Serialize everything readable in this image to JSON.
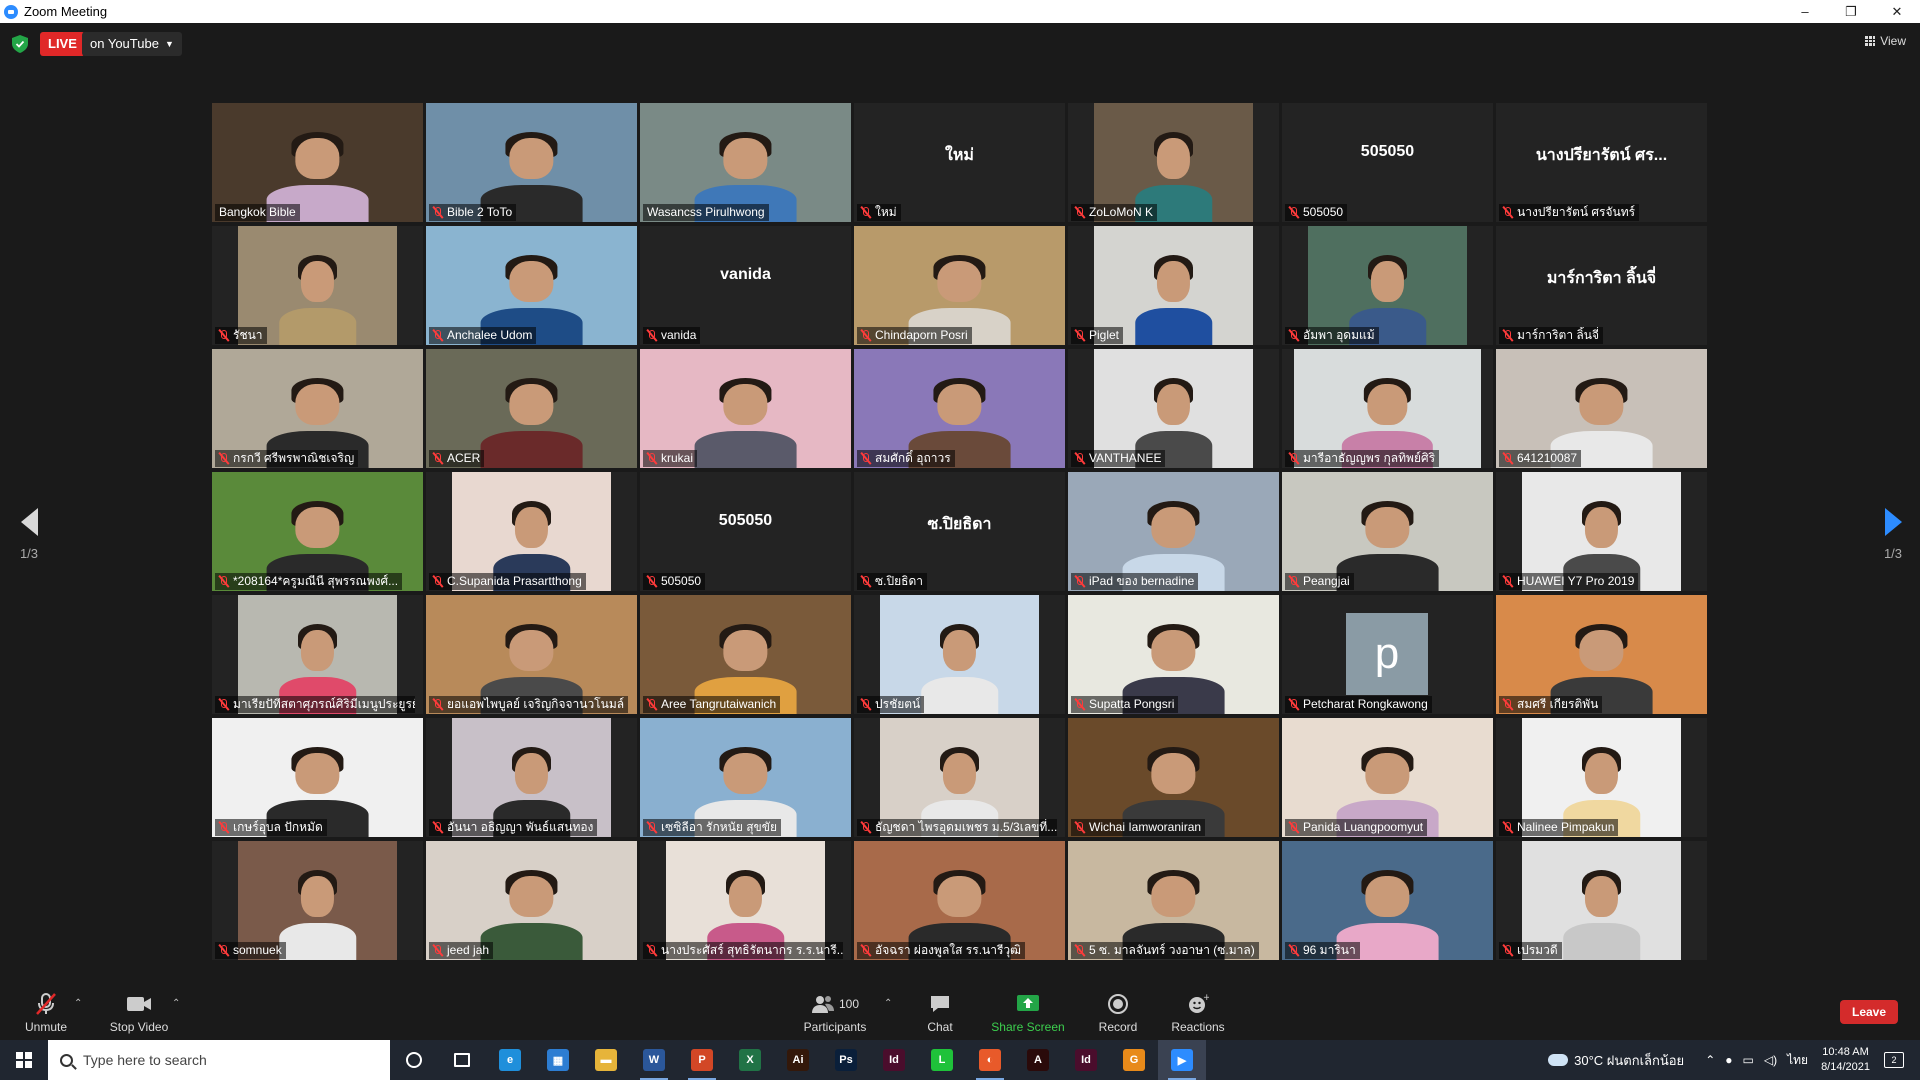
{
  "window": {
    "title": "Zoom Meeting",
    "minimize": "–",
    "restore": "❐",
    "close": "✕"
  },
  "header": {
    "live_label": "LIVE",
    "stream_target": "on YouTube",
    "view_label": "View"
  },
  "pagination": {
    "left": "1/3",
    "right": "1/3"
  },
  "participants": [
    {
      "name": "Bangkok Bible",
      "muted": false,
      "video": true,
      "active": true,
      "bg": "#4a3a2c",
      "shirt": "#c7a9c9",
      "frame": "full"
    },
    {
      "name": "Bible 2 ToTo",
      "muted": true,
      "video": true,
      "bg": "#6f8fa8",
      "shirt": "#2a2a2a",
      "frame": "full"
    },
    {
      "name": "Wasancss Pirulhwong",
      "muted": false,
      "video": true,
      "bg": "#7a8a86",
      "shirt": "#3f78b8",
      "frame": "full"
    },
    {
      "name": "ใหม่",
      "muted": true,
      "video": false,
      "display": "ใหม่"
    },
    {
      "name": "ZoLoMoN K",
      "muted": true,
      "video": true,
      "bg": "#6a5a48",
      "shirt": "#2d7a7a",
      "frame": "narrow"
    },
    {
      "name": "505050",
      "muted": true,
      "video": false,
      "display": "505050"
    },
    {
      "name": "นางปรียารัตน์ ศรจันทร์",
      "muted": true,
      "video": false,
      "display": "นางปรียารัตน์ ศร..."
    },
    {
      "name": "รัชนา",
      "muted": true,
      "video": true,
      "bg": "#9a8a70",
      "shirt": "#b39a6a",
      "frame": "narrow"
    },
    {
      "name": "Anchalee Udom",
      "muted": true,
      "video": true,
      "bg": "#8ab4d0",
      "shirt": "#1e4c86",
      "frame": "full"
    },
    {
      "name": "vanida",
      "muted": true,
      "video": false,
      "display": "vanida"
    },
    {
      "name": "Chindaporn Posri",
      "muted": true,
      "video": true,
      "bg": "#b89a6a",
      "shirt": "#d8d2c8",
      "frame": "full"
    },
    {
      "name": "Piglet",
      "muted": true,
      "video": true,
      "bg": "#d4d4d0",
      "shirt": "#1f4fa0",
      "frame": "narrow"
    },
    {
      "name": "อัมพา อุดมแม้",
      "muted": true,
      "video": true,
      "bg": "#4f6f5f",
      "shirt": "#3a5a8a",
      "frame": "narrow"
    },
    {
      "name": "มาร์การิตา ลิ้นจี่",
      "muted": true,
      "video": false,
      "display": "มาร์การิตา ลิ้นจี่"
    },
    {
      "name": "กรกวี ศรีพรพาณิชเจริญ",
      "muted": true,
      "video": true,
      "bg": "#b0a898",
      "shirt": "#2a2a2a",
      "frame": "full"
    },
    {
      "name": "ACER",
      "muted": true,
      "video": true,
      "bg": "#6a6a58",
      "shirt": "#6a2a2a",
      "frame": "full"
    },
    {
      "name": "krukai",
      "muted": true,
      "video": true,
      "bg": "#e6b8c4",
      "shirt": "#5a5a6a",
      "frame": "full"
    },
    {
      "name": "สมศักดิ์ อุถาวร",
      "muted": true,
      "video": true,
      "bg": "#8a78b8",
      "shirt": "#6a4a3a",
      "frame": "full"
    },
    {
      "name": "VANTHANEE",
      "muted": true,
      "video": true,
      "bg": "#e0e0e0",
      "shirt": "#4a4a4a",
      "frame": "narrow"
    },
    {
      "name": "มารีอาธัญญพร กุลทิพย์ศิริ",
      "muted": true,
      "video": true,
      "bg": "#d8dcdc",
      "shirt": "#c880a8",
      "frame": "mid"
    },
    {
      "name": "641210087",
      "muted": true,
      "video": true,
      "bg": "#c8c0b8",
      "shirt": "#e8e8e8",
      "frame": "full"
    },
    {
      "name": "*208164*ครูมณีนี สุพรรณพงศ์...",
      "muted": true,
      "video": true,
      "bg": "#5a8a3a",
      "shirt": "#2a2a2a",
      "frame": "full"
    },
    {
      "name": "C.Supanida Prasartthong",
      "muted": true,
      "video": true,
      "bg": "#e8d8d0",
      "shirt": "#2a3a5a",
      "frame": "narrow"
    },
    {
      "name": "505050",
      "muted": true,
      "video": false,
      "display": "505050"
    },
    {
      "name": "ซ.ปิยธิดา",
      "muted": true,
      "video": false,
      "display": "ซ.ปิยธิดา"
    },
    {
      "name": "iPad ของ bernadine",
      "muted": true,
      "video": true,
      "bg": "#9aa8b8",
      "shirt": "#c8d8e8",
      "frame": "full"
    },
    {
      "name": "Peangjai",
      "muted": true,
      "video": true,
      "bg": "#c8c8c0",
      "shirt": "#2a2a2a",
      "frame": "full"
    },
    {
      "name": "HUAWEI Y7 Pro 2019",
      "muted": true,
      "video": true,
      "bg": "#e8e8e8",
      "shirt": "#4a4a4a",
      "frame": "narrow"
    },
    {
      "name": "มาเรียปัทีสตาศุภรณ์ศิริมีเมนูประยูรย์",
      "muted": true,
      "video": true,
      "bg": "#b8b8b0",
      "shirt": "#e04a6a",
      "frame": "narrow"
    },
    {
      "name": "ยอแอพไพบูลย์ เจริญกิจจานวโนมล์",
      "muted": true,
      "video": true,
      "bg": "#b88a5a",
      "shirt": "#4a4a4a",
      "frame": "full"
    },
    {
      "name": "Aree Tangrutaiwanich",
      "muted": true,
      "video": true,
      "bg": "#7a5a3a",
      "shirt": "#e0a040",
      "frame": "full"
    },
    {
      "name": "ปรชัยตน์",
      "muted": true,
      "video": true,
      "bg": "#c8d8e8",
      "shirt": "#e8e8e8",
      "frame": "narrow"
    },
    {
      "name": "Supatta Pongsri",
      "muted": true,
      "video": true,
      "bg": "#e8e8e0",
      "shirt": "#3a3a4a",
      "frame": "full"
    },
    {
      "name": "Petcharat Rongkawong",
      "muted": true,
      "video": false,
      "avatar": "p"
    },
    {
      "name": "สมศรี เกียรติพัน",
      "muted": true,
      "video": true,
      "bg": "#d88a4a",
      "shirt": "#3a3a3a",
      "frame": "full"
    },
    {
      "name": "เกษร์อุบล ปักหมัด",
      "muted": true,
      "video": true,
      "bg": "#f0f0f0",
      "shirt": "#2a2a2a",
      "frame": "full"
    },
    {
      "name": "อันนา อธิญญา พันธ์แสนทอง",
      "muted": true,
      "video": true,
      "bg": "#c8c0c8",
      "shirt": "#2a2a2a",
      "frame": "narrow"
    },
    {
      "name": "เซซิลีอา รักหนัย สุขขัย",
      "muted": true,
      "video": true,
      "bg": "#8ab0d0",
      "shirt": "#e8e8e8",
      "frame": "full"
    },
    {
      "name": "ธัญชดา ไพรอุดมเพชร ม.5/3เลขที่...",
      "muted": true,
      "video": true,
      "bg": "#d8d0c8",
      "shirt": "#e8e8e8",
      "frame": "narrow"
    },
    {
      "name": "Wichai Iamworaniran",
      "muted": true,
      "video": true,
      "bg": "#6a4a2a",
      "shirt": "#3a3a3a",
      "frame": "full"
    },
    {
      "name": "Panida Luangpoomyut",
      "muted": true,
      "video": true,
      "bg": "#e8dcd0",
      "shirt": "#c8a8c8",
      "frame": "full"
    },
    {
      "name": "Nalinee Pimpakun",
      "muted": true,
      "video": true,
      "bg": "#f0f0f0",
      "shirt": "#f0d8a0",
      "frame": "narrow"
    },
    {
      "name": "somnuek",
      "muted": true,
      "video": true,
      "bg": "#7a5a4a",
      "shirt": "#e8e8e8",
      "frame": "narrow"
    },
    {
      "name": "jeed jah",
      "muted": true,
      "video": true,
      "bg": "#d8d0c8",
      "shirt": "#3a5a3a",
      "frame": "full"
    },
    {
      "name": "นางประศัสร์ สุทธิรัตนากร ร.ร.นารี...",
      "muted": true,
      "video": true,
      "bg": "#e8e0d8",
      "shirt": "#c85a8a",
      "frame": "narrow"
    },
    {
      "name": "อัจฉรา ผ่องพูลใส รร.นารีวุฒิ",
      "muted": true,
      "video": true,
      "bg": "#a86a4a",
      "shirt": "#2a2a2a",
      "frame": "full"
    },
    {
      "name": "5 ซ. มาลจันทร์ วงอาษา (ซ.มาล)",
      "muted": true,
      "video": true,
      "bg": "#c8b8a0",
      "shirt": "#2a2a2a",
      "frame": "full"
    },
    {
      "name": "96 มารินา",
      "muted": true,
      "video": true,
      "bg": "#4a6a8a",
      "shirt": "#e8a8c8",
      "frame": "full"
    },
    {
      "name": "เปรมวดี",
      "muted": true,
      "video": true,
      "bg": "#e0e0e0",
      "shirt": "#c8c8c8",
      "frame": "narrow"
    }
  ],
  "toolbar": {
    "unmute": "Unmute",
    "stop_video": "Stop Video",
    "participants": "Participants",
    "participants_count": "100",
    "chat": "Chat",
    "share_screen": "Share Screen",
    "record": "Record",
    "reactions": "Reactions",
    "leave": "Leave",
    "share_color": "#3ccf4e"
  },
  "taskbar": {
    "search_placeholder": "Type here to search",
    "apps": [
      {
        "name": "cortana-icon",
        "label": "",
        "color": "transparent",
        "running": false
      },
      {
        "name": "task-view-icon",
        "label": "",
        "color": "transparent",
        "running": false
      },
      {
        "name": "edge-icon",
        "label": "e",
        "color": "#1f8fdb",
        "running": false
      },
      {
        "name": "calculator-icon",
        "label": "▦",
        "color": "#2d7dd2",
        "running": false
      },
      {
        "name": "file-explorer-icon",
        "label": "▬",
        "color": "#e6b43a",
        "running": false
      },
      {
        "name": "word-icon",
        "label": "W",
        "color": "#2b579a",
        "running": true
      },
      {
        "name": "powerpoint-icon",
        "label": "P",
        "color": "#d24726",
        "running": true
      },
      {
        "name": "excel-icon",
        "label": "X",
        "color": "#217346",
        "running": false
      },
      {
        "name": "illustrator-icon",
        "label": "Ai",
        "color": "#33180a",
        "running": false
      },
      {
        "name": "photoshop-icon",
        "label": "Ps",
        "color": "#0a1f3a",
        "running": false
      },
      {
        "name": "indesign-icon",
        "label": "Id",
        "color": "#4a0d2c",
        "running": false
      },
      {
        "name": "line-icon",
        "label": "L",
        "color": "#1fc23a",
        "running": false
      },
      {
        "name": "firefox-icon",
        "label": "◐",
        "color": "#e85a2a",
        "running": true
      },
      {
        "name": "acrobat-icon",
        "label": "A",
        "color": "#2a0a0a",
        "running": false
      },
      {
        "name": "indesign-2-icon",
        "label": "Id",
        "color": "#4a0d2c",
        "running": false
      },
      {
        "name": "g-app-icon",
        "label": "G",
        "color": "#e88a1a",
        "running": false
      },
      {
        "name": "zoom-icon",
        "label": "▶",
        "color": "#2d8cff",
        "running": true,
        "active": true
      }
    ],
    "weather": "30°C ฝนตกเล็กน้อย",
    "language": "ไทย",
    "time": "10:48 AM",
    "date": "8/14/2021",
    "notifications": "2"
  }
}
